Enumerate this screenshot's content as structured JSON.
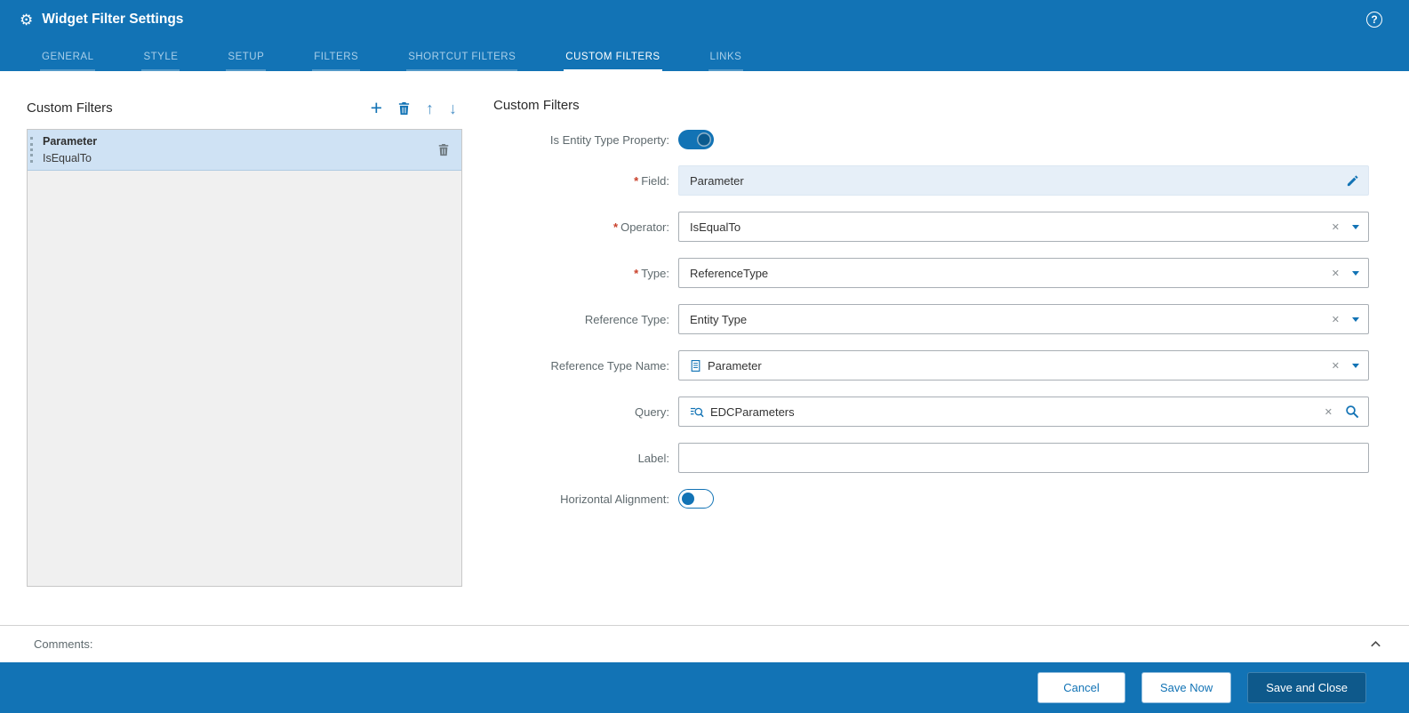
{
  "header": {
    "title": "Widget Filter Settings",
    "tabs": [
      {
        "label": "GENERAL",
        "active": false
      },
      {
        "label": "STYLE",
        "active": false
      },
      {
        "label": "SETUP",
        "active": false
      },
      {
        "label": "FILTERS",
        "active": false
      },
      {
        "label": "SHORTCUT FILTERS",
        "active": false
      },
      {
        "label": "CUSTOM FILTERS",
        "active": true
      },
      {
        "label": "LINKS",
        "active": false
      }
    ]
  },
  "left_panel": {
    "title": "Custom Filters",
    "items": [
      {
        "field": "Parameter",
        "operator": "IsEqualTo",
        "selected": true
      }
    ]
  },
  "form": {
    "title": "Custom Filters",
    "is_entity_type_property": {
      "label": "Is Entity Type Property:",
      "value": true
    },
    "field": {
      "label": "Field:",
      "required": true,
      "value": "Parameter"
    },
    "operator": {
      "label": "Operator:",
      "required": true,
      "value": "IsEqualTo"
    },
    "type": {
      "label": "Type:",
      "required": true,
      "value": "ReferenceType"
    },
    "reference_type": {
      "label": "Reference Type:",
      "required": false,
      "value": "Entity Type"
    },
    "reference_type_name": {
      "label": "Reference Type Name:",
      "required": false,
      "value": "Parameter"
    },
    "query": {
      "label": "Query:",
      "required": false,
      "value": "EDCParameters"
    },
    "label_field": {
      "label": "Label:",
      "required": false,
      "value": "",
      "placeholder": ""
    },
    "horizontal_alignment": {
      "label": "Horizontal Alignment:",
      "value": false
    }
  },
  "comments": {
    "label": "Comments:"
  },
  "footer": {
    "cancel_label": "Cancel",
    "save_now_label": "Save Now",
    "save_and_close_label": "Save and Close"
  },
  "icons": {
    "gear": "⚙",
    "help": "?",
    "add": "+",
    "move_up": "↑",
    "move_down": "↓",
    "clear": "✕"
  },
  "misc": {
    "required_marker": "*"
  },
  "colors": {
    "primary": "#1273B5",
    "footer_bg": "#1273B5",
    "save_close_bg": "#0E598B",
    "tab_inactive": "#A9CFE9",
    "readonly_bg": "#E6EFF8",
    "selected_item_bg": "#CFE2F4",
    "panel_bg": "#F0F0F0",
    "input_border": "#A9AFB5",
    "label_color": "#5F6A6E",
    "required_color": "#C9402A",
    "icon_gray": "#8A9094"
  }
}
